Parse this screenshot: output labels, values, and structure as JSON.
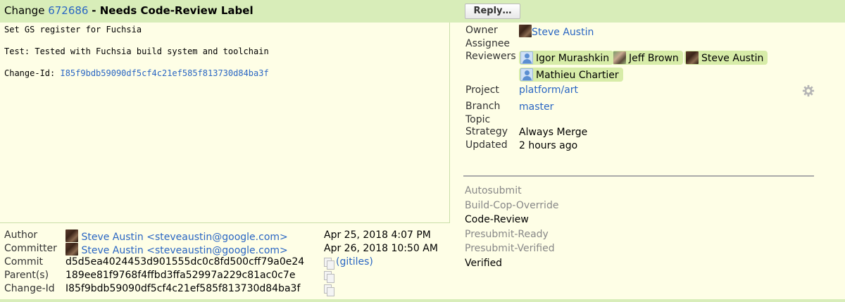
{
  "header": {
    "change_prefix": "Change",
    "change_number": "672686",
    "status": "- Needs Code-Review Label",
    "reply_label": "Reply…"
  },
  "message": {
    "line1": "Set GS register for Fuchsia",
    "line2": "Test: Tested with Fuchsia build system and toolchain",
    "change_id_label": "Change-Id:",
    "change_id": "I85f9bdb59090df5cf4c21ef585f813730d84ba3f"
  },
  "info": {
    "owner_label": "Owner",
    "owner": "Steve Austin",
    "assignee_label": "Assignee",
    "reviewers_label": "Reviewers",
    "reviewers": [
      "Igor Murashkin",
      "Jeff Brown",
      "Steve Austin",
      "Mathieu Chartier"
    ],
    "project_label": "Project",
    "project": "platform/art",
    "branch_label": "Branch",
    "branch": "master",
    "topic_label": "Topic",
    "strategy_label": "Strategy",
    "strategy": "Always Merge",
    "updated_label": "Updated",
    "updated": "2 hours ago",
    "icons": {
      "settings": "gear-icon"
    }
  },
  "labels": [
    {
      "name": "Autosubmit",
      "muted": true
    },
    {
      "name": "Build-Cop-Override",
      "muted": true
    },
    {
      "name": "Code-Review",
      "muted": false
    },
    {
      "name": "Presubmit-Ready",
      "muted": true
    },
    {
      "name": "Presubmit-Verified",
      "muted": true
    },
    {
      "name": "Verified",
      "muted": false
    }
  ],
  "commit_info": {
    "author_label": "Author",
    "author": "Steve Austin <steveaustin@google.com>",
    "author_date": "Apr 25, 2018 4:07 PM",
    "committer_label": "Committer",
    "committer": "Steve Austin <steveaustin@google.com>",
    "committer_date": "Apr 26, 2018 10:50 AM",
    "commit_label": "Commit",
    "commit": "d5d5ea4024453d901555dc0c8fd500cff79a0e24",
    "gitiles_label": "(gitiles)",
    "parents_label": "Parent(s)",
    "parents": "189ee81f9768f4ffbd3ffa52997a229c81ac0c7e",
    "change_id_label": "Change-Id",
    "change_id": "I85f9bdb59090df5cf4c21ef585f813730d84ba3f"
  },
  "colors": {
    "background": "#fefee6",
    "header": "#d8edb9",
    "link": "#2a66c3",
    "chip": "#d7eca8"
  }
}
